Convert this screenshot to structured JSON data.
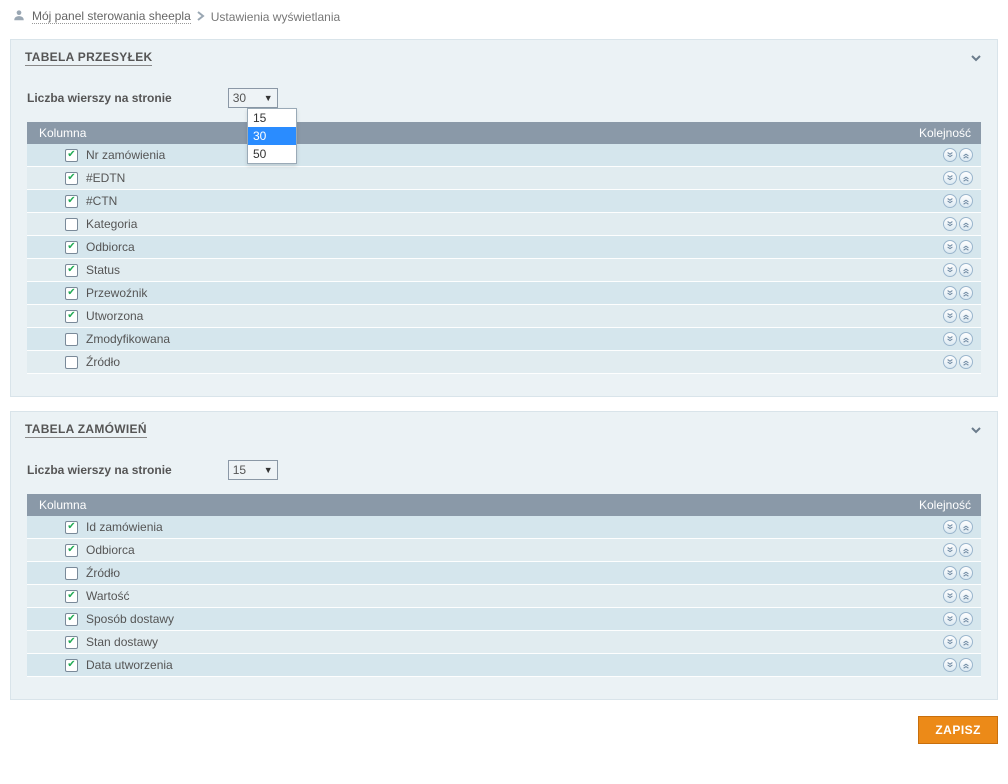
{
  "breadcrumb": {
    "home": "Mój panel sterowania sheepla",
    "current": "Ustawienia wyświetlania"
  },
  "common": {
    "rows_label": "Liczba wierszy na stronie",
    "col_header": "Kolumna",
    "order_header": "Kolejność"
  },
  "save_label": "ZAPISZ",
  "panels": [
    {
      "title": "TABELA PRZESYŁEK",
      "rows_value": "30",
      "dropdown_open": true,
      "dropdown_options": [
        "15",
        "30",
        "50"
      ],
      "columns": [
        {
          "label": "Nr zamówienia",
          "checked": true
        },
        {
          "label": "#EDTN",
          "checked": true
        },
        {
          "label": "#CTN",
          "checked": true
        },
        {
          "label": "Kategoria",
          "checked": false
        },
        {
          "label": "Odbiorca",
          "checked": true
        },
        {
          "label": "Status",
          "checked": true
        },
        {
          "label": "Przewoźnik",
          "checked": true
        },
        {
          "label": "Utworzona",
          "checked": true
        },
        {
          "label": "Zmodyfikowana",
          "checked": false
        },
        {
          "label": "Źródło",
          "checked": false
        }
      ]
    },
    {
      "title": "TABELA ZAMÓWIEŃ",
      "rows_value": "15",
      "dropdown_open": false,
      "dropdown_options": [
        "15",
        "30",
        "50"
      ],
      "columns": [
        {
          "label": "Id zamówienia",
          "checked": true
        },
        {
          "label": "Odbiorca",
          "checked": true
        },
        {
          "label": "Źródło",
          "checked": false
        },
        {
          "label": "Wartość",
          "checked": true
        },
        {
          "label": "Sposób dostawy",
          "checked": true
        },
        {
          "label": "Stan dostawy",
          "checked": true
        },
        {
          "label": "Data utworzenia",
          "checked": true
        }
      ]
    }
  ]
}
